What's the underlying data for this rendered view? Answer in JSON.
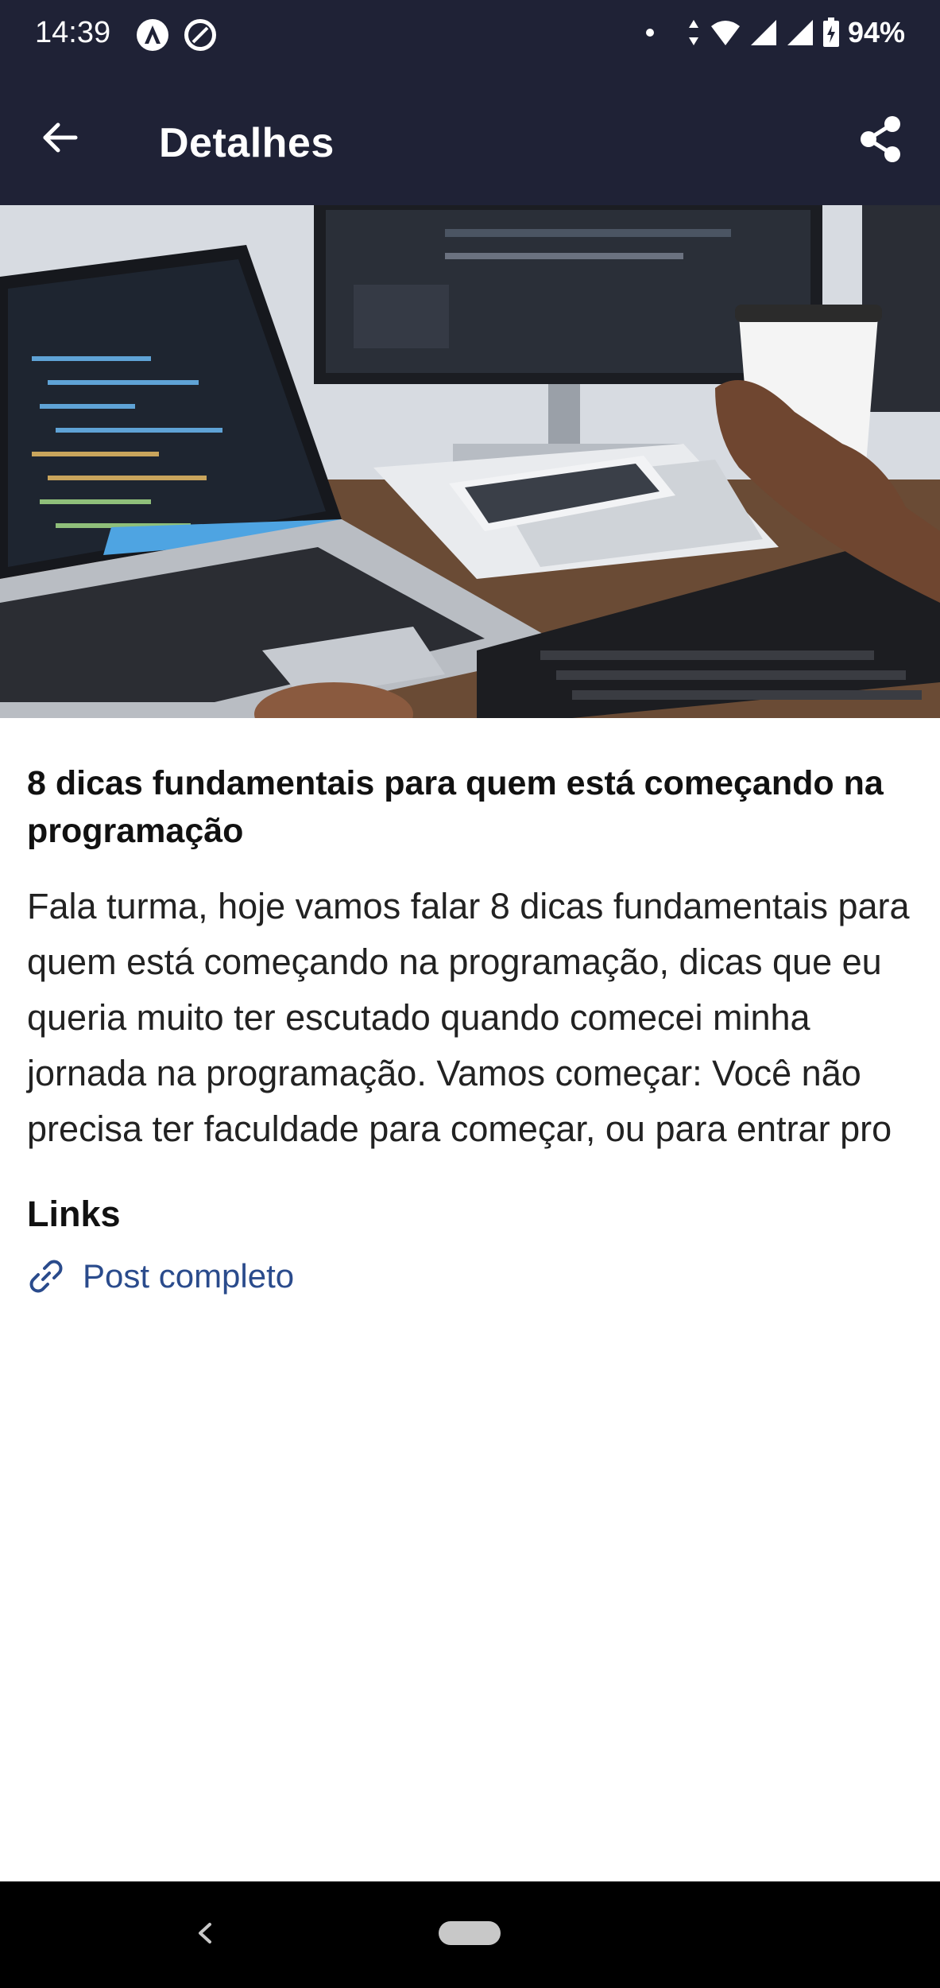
{
  "status_bar": {
    "time": "14:39",
    "battery": "94%",
    "icons": [
      "angular-icon",
      "dnd-icon",
      "data-arrows-icon",
      "wifi-icon",
      "signal-icon",
      "signal-icon",
      "battery-icon"
    ]
  },
  "app_bar": {
    "title": "Detalhes",
    "back_icon": "arrow-left-icon",
    "share_icon": "share-icon",
    "background": "#1f2236"
  },
  "post": {
    "title": "8 dicas fundamentais para quem está começando na programação",
    "body": "Fala turma, hoje vamos falar 8 dicas fundamentais para quem está começando na programação, dicas que eu queria muito ter escutado quando comecei minha jornada na programação. Vamos começar: Você não precisa ter faculdade para começar, ou para entrar pro"
  },
  "links": {
    "heading": "Links",
    "items": [
      {
        "label": "Post completo",
        "icon": "link-icon"
      }
    ],
    "link_color": "#2a4b8c"
  },
  "nav_bar": {
    "back_icon": "nav-back-icon",
    "home_icon": "home-pill-icon"
  }
}
